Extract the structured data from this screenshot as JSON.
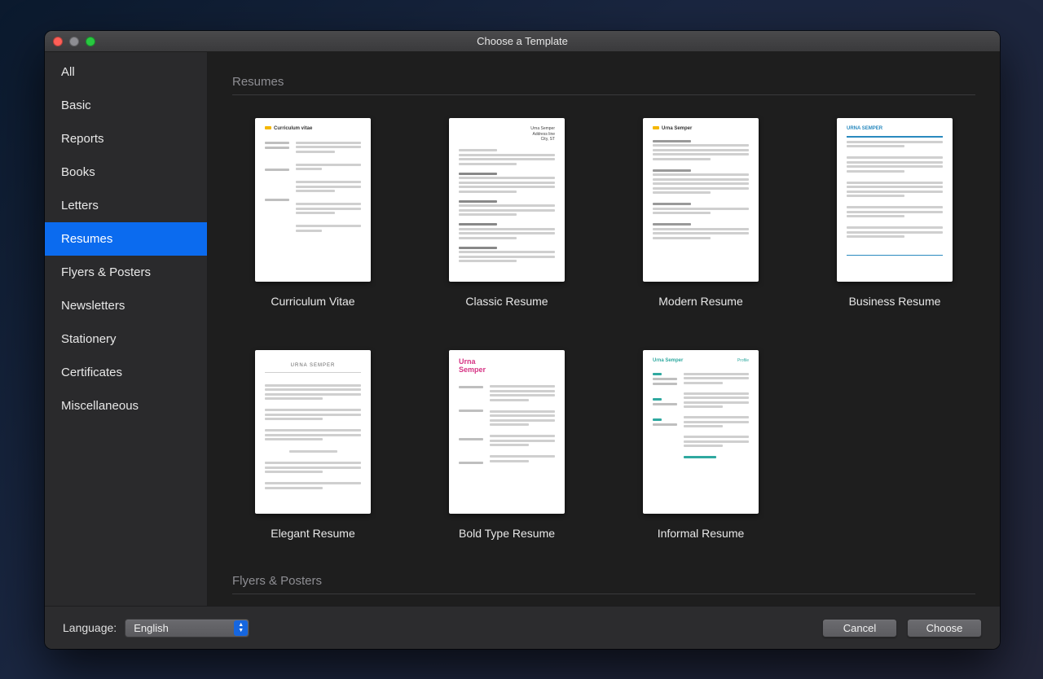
{
  "window": {
    "title": "Choose a Template"
  },
  "sidebar": {
    "items": [
      {
        "label": "All",
        "selected": false
      },
      {
        "label": "Basic",
        "selected": false
      },
      {
        "label": "Reports",
        "selected": false
      },
      {
        "label": "Books",
        "selected": false
      },
      {
        "label": "Letters",
        "selected": false
      },
      {
        "label": "Resumes",
        "selected": true
      },
      {
        "label": "Flyers & Posters",
        "selected": false
      },
      {
        "label": "Newsletters",
        "selected": false
      },
      {
        "label": "Stationery",
        "selected": false
      },
      {
        "label": "Certificates",
        "selected": false
      },
      {
        "label": "Miscellaneous",
        "selected": false
      }
    ]
  },
  "content": {
    "sections": [
      {
        "title": "Resumes",
        "templates": [
          {
            "label": "Curriculum Vitae"
          },
          {
            "label": "Classic Resume"
          },
          {
            "label": "Modern Resume"
          },
          {
            "label": "Business Resume"
          },
          {
            "label": "Elegant Resume"
          },
          {
            "label": "Bold Type Resume"
          },
          {
            "label": "Informal Resume"
          }
        ]
      },
      {
        "title": "Flyers & Posters",
        "templates": []
      }
    ]
  },
  "footer": {
    "language_label": "Language:",
    "language_value": "English",
    "cancel": "Cancel",
    "choose": "Choose"
  }
}
